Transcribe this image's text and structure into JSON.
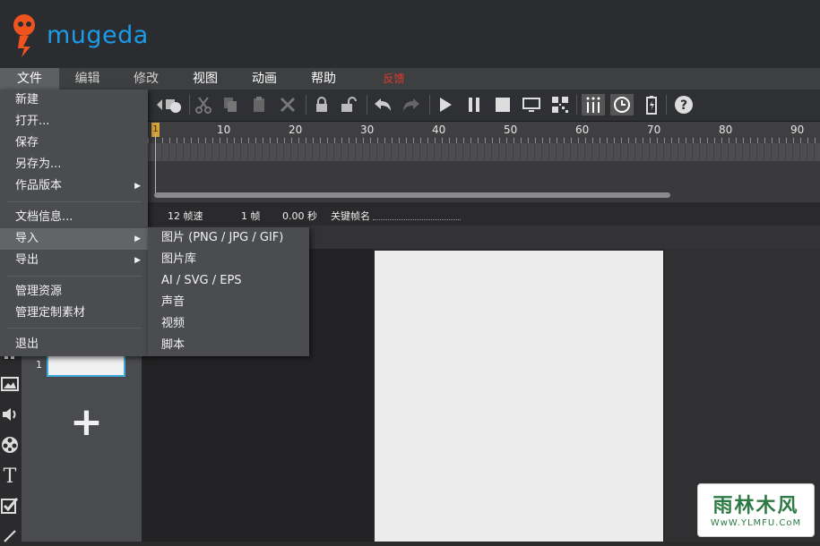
{
  "app": {
    "logo_text": "mugeda"
  },
  "menubar": {
    "file": "文件",
    "edit": "编辑",
    "modify": "修改",
    "view": "视图",
    "animation": "动画",
    "help": "帮助",
    "feedback": "反馈"
  },
  "file_menu": {
    "items": [
      "新建",
      "打开...",
      "保存",
      "另存为...",
      "作品版本",
      "文档信息...",
      "导入",
      "导出",
      "管理资源",
      "管理定制素材",
      "退出"
    ]
  },
  "import_submenu": {
    "items": [
      "图片 (PNG / JPG / GIF)",
      "图片库",
      "AI / SVG / EPS",
      "声音",
      "视频",
      "脚本"
    ]
  },
  "timeline": {
    "ruler_labels": [
      "10",
      "20",
      "30",
      "40",
      "50",
      "60",
      "70",
      "80",
      "90"
    ],
    "playhead_frame": "1"
  },
  "statusbar": {
    "fps": "12 帧速",
    "frame": "1 帧",
    "seconds": "0.00 秒",
    "keyframe_label": "关键帧名"
  },
  "pages": {
    "page_number": "1",
    "add_symbol": "+"
  },
  "watermark": {
    "title": "雨林木风",
    "url": "WwW.YLMFU.CoM"
  },
  "colors": {
    "accent": "#1c9be8",
    "feedback": "#e23a2a",
    "thumb_border": "#3fa9d9"
  },
  "icons": [
    "cut-icon",
    "copy-icon",
    "paste-icon",
    "delete-icon",
    "lock-icon",
    "unlock-icon",
    "undo-icon",
    "redo-icon",
    "play-icon",
    "pause-icon",
    "stop-icon",
    "preview-icon",
    "qrcode-icon",
    "bars-icon",
    "clock-icon",
    "battery-icon",
    "help-icon"
  ]
}
